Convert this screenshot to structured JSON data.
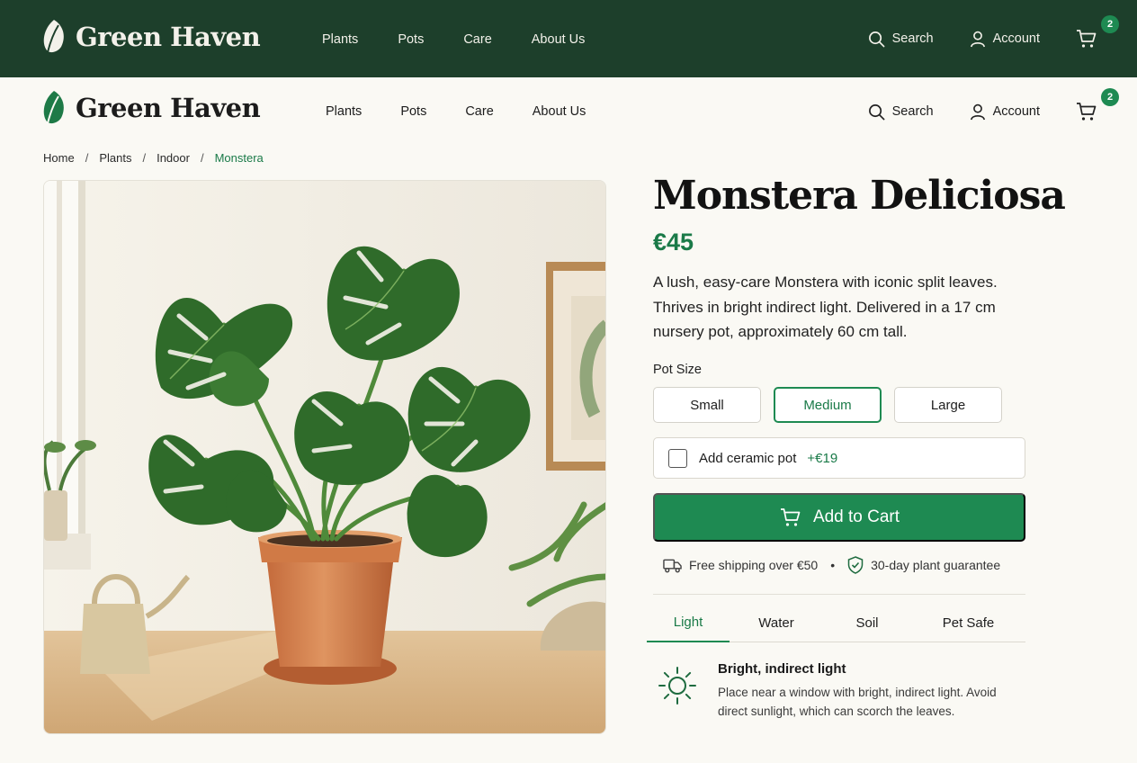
{
  "brand": {
    "name": "Green Haven"
  },
  "nav": {
    "items": [
      {
        "label": "Plants"
      },
      {
        "label": "Pots"
      },
      {
        "label": "Care"
      },
      {
        "label": "About Us"
      }
    ]
  },
  "header": {
    "search_label": "Search",
    "account_label": "Account",
    "cart_count": "2"
  },
  "breadcrumb": [
    {
      "label": "Home"
    },
    {
      "label": "Plants"
    },
    {
      "label": "Indoor"
    },
    {
      "label": "Monstera"
    }
  ],
  "breadcrumb_separator": "/",
  "product": {
    "title": "Monstera Deliciosa",
    "price": "€45",
    "description": "A lush, easy-care Monstera with iconic split leaves. Thrives in bright indirect light. Delivered in a 17 cm nursery pot, approximately 60 cm tall.",
    "pot_size_label": "Pot Size",
    "sizes": [
      {
        "label": "Small"
      },
      {
        "label": "Medium"
      },
      {
        "label": "Large"
      }
    ],
    "selected_size": "Medium",
    "addon": {
      "label": "Add ceramic pot",
      "price": "+€19",
      "checked": false
    },
    "cta_label": "Add to Cart",
    "perks": {
      "shipping": "Free shipping over €50",
      "separator": "•",
      "guarantee": "30-day plant guarantee"
    }
  },
  "care_tabs": [
    {
      "label": "Light"
    },
    {
      "label": "Water"
    },
    {
      "label": "Soil"
    },
    {
      "label": "Pet Safe"
    }
  ],
  "active_tab": "Light",
  "care_info": {
    "heading": "Bright, indirect light",
    "body": "Place near a window with bright, indirect light. Avoid direct sunlight, which can scorch the leaves."
  },
  "colors": {
    "header_bg": "#1d3f2b",
    "accent": "#1e8a52",
    "page_bg": "#faf9f4"
  }
}
